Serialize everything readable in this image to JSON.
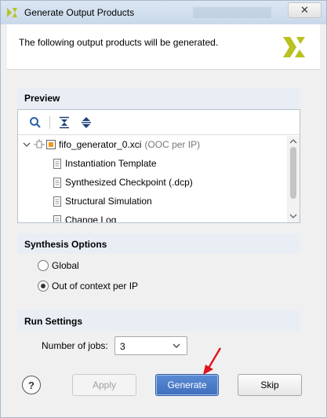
{
  "window": {
    "title": "Generate Output Products",
    "close_glyph": "✕"
  },
  "header": {
    "message": "The following output products will be generated.",
    "logo_icon": "xilinx-logo",
    "logo_color": "#b9c21f"
  },
  "preview": {
    "title": "Preview",
    "toolbar": {
      "search_icon": "search-icon",
      "collapse_all_icon": "collapse-all-icon",
      "expand_all_icon": "expand-all-icon"
    },
    "tree": {
      "root": {
        "label": "fifo_generator_0.xci",
        "suffix": "(OOC per IP)"
      },
      "children": [
        {
          "label": "Instantiation Template"
        },
        {
          "label": "Synthesized Checkpoint (.dcp)"
        },
        {
          "label": "Structural Simulation"
        },
        {
          "label": "Change Log"
        }
      ]
    }
  },
  "synthesis": {
    "title": "Synthesis Options",
    "options": [
      {
        "label": "Global",
        "selected": false
      },
      {
        "label": "Out of context per IP",
        "selected": true
      }
    ]
  },
  "run_settings": {
    "title": "Run Settings",
    "jobs_label": "Number of jobs:",
    "jobs_value": "3"
  },
  "buttons": {
    "help": "?",
    "apply": "Apply",
    "generate": "Generate",
    "skip": "Skip"
  },
  "colors": {
    "accent": "#3f6fbd",
    "arrow": "#e0131b",
    "section_bg": "#e9eef5"
  }
}
